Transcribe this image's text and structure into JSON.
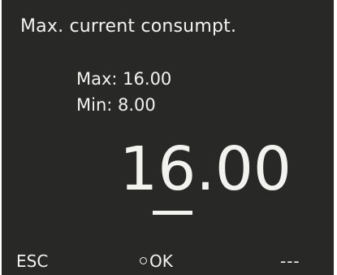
{
  "screen": {
    "title": "Max. current consumpt.",
    "limits": {
      "max_label": "Max: 16.00",
      "min_label": "Min: 8.00"
    },
    "value": {
      "digits": [
        "1",
        "6",
        ".",
        "0",
        "0"
      ],
      "cursor_position": 1
    },
    "softkeys": {
      "left": "ESC",
      "center": "OK",
      "right": "---"
    }
  },
  "colors": {
    "background": "#282826",
    "foreground": "#f2f2ef"
  }
}
